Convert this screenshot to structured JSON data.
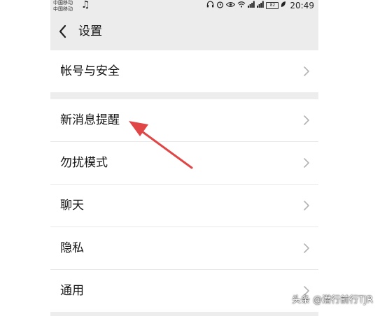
{
  "status_bar": {
    "carrier_1": "中国移动",
    "carrier_2": "中国移动",
    "battery": "82",
    "time": "20:49"
  },
  "header": {
    "title": "设置"
  },
  "settings": {
    "group1": [
      {
        "label": "帐号与安全"
      }
    ],
    "group2": [
      {
        "label": "新消息提醒"
      },
      {
        "label": "勿扰模式"
      },
      {
        "label": "聊天"
      },
      {
        "label": "隐私"
      },
      {
        "label": "通用"
      }
    ]
  },
  "colors": {
    "accent_arrow": "#e04646",
    "page_background": "#ededed",
    "row_background": "#ffffff"
  },
  "watermark": "头条 @潜行前行TJR"
}
